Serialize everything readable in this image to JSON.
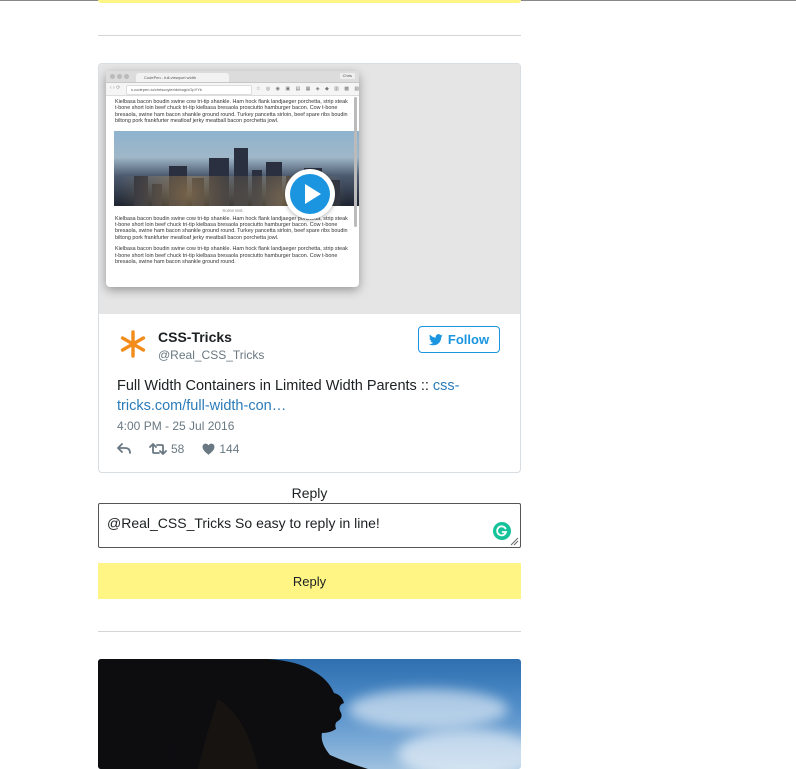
{
  "tweet": {
    "media": {
      "browser_tab_title": "CodePen - full-viewport width",
      "browser_user": "Chris",
      "url": "s.codepen.io/chriscoyier/debug/xOpYYk",
      "paragraph_1": "Kielbasa bacon boudin swine cow tri-tip shankle. Ham hock flank landjaeger porchetta, strip steak t-bone short loin beef chuck tri-tip kielbasa bresaola prosciutto hamburger bacon. Cow t-bone bresaola, swine ham bacon shankle ground round. Turkey pancetta sirloin, beef spare ribs boudin biltong pork frankfurter meatloaf jerky meatball bacon porchetta jowl.",
      "image_caption": "Some text.",
      "paragraph_2": "Kielbasa bacon boudin swine cow tri-tip shankle. Ham hock flank landjaeger porchetta, strip steak t-bone short loin beef chuck tri-tip kielbasa bresaola prosciutto hamburger bacon. Cow t-bone bresaola, swine ham bacon shankle ground round. Turkey pancetta sirloin, beef spare ribs boudin biltong pork frankfurter meatloaf jerky meatball bacon porchetta jowl.",
      "paragraph_3": "Kielbasa bacon boudin swine cow tri-tip shankle. Ham hock flank landjaeger porchetta, strip steak t-bone short loin beef chuck tri-tip kielbasa bresaola prosciutto hamburger bacon. Cow t-bone bresaola, swine ham bacon shankle ground round.",
      "play_icon": "play-icon"
    },
    "author_name": "CSS-Tricks",
    "author_handle": "@Real_CSS_Tricks",
    "follow_label": "Follow",
    "text_prefix": "Full Width Containers in Limited Width Parents :: ",
    "link_text": "css-tricks.com/full-width-con…",
    "timestamp": "4:00 PM - 25 Jul 2016",
    "retweet_count": "58",
    "like_count": "144"
  },
  "reply": {
    "label": "Reply",
    "input_value": "@Real_CSS_Tricks So easy to reply in line!",
    "button_label": "Reply"
  },
  "colors": {
    "accent_yellow": "#fff585",
    "twitter_blue": "#1b95e0",
    "link_blue": "#2b7bb9",
    "grammarly_green": "#15c39a"
  }
}
